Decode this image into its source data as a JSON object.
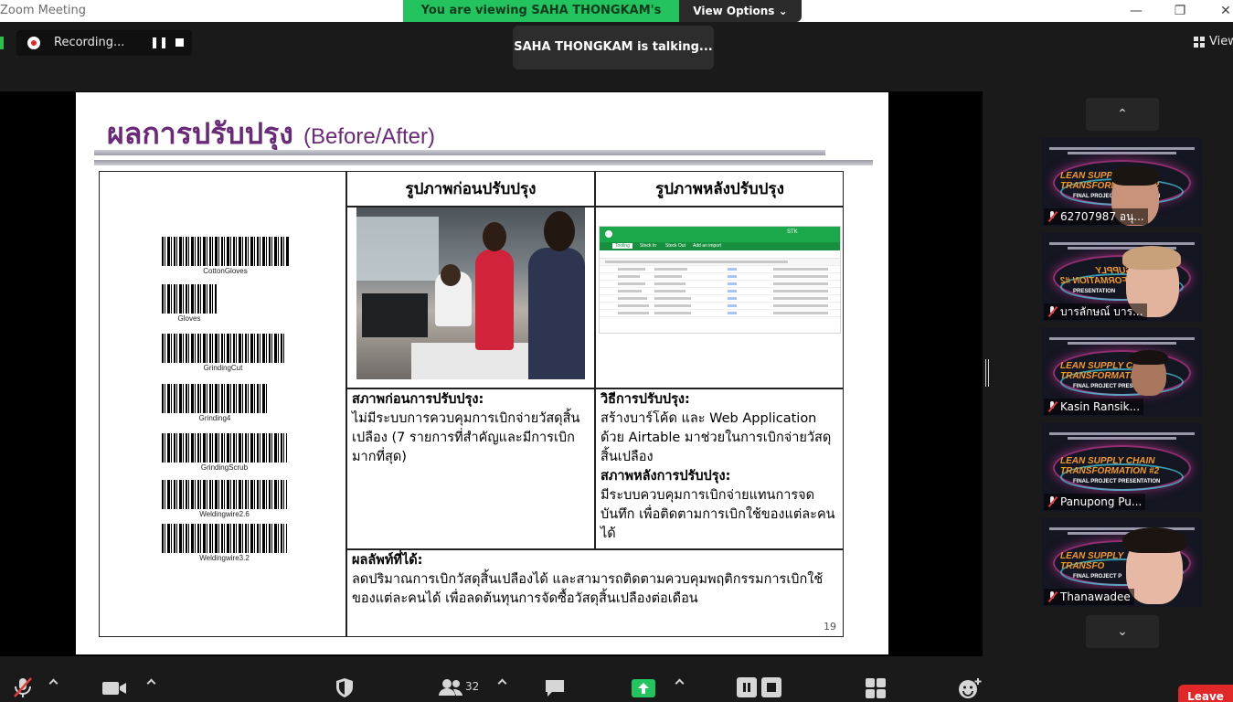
{
  "window": {
    "app_title": "Zoom Meeting",
    "viewing_banner": "You are viewing SAHA THONGKAM's screen",
    "view_options": "View Options",
    "view_options_caret": "⌄",
    "minimize": "—",
    "restore": "❐",
    "close": "✕"
  },
  "overlay": {
    "recording_label": "Recording...",
    "pause_glyph": "❚❚",
    "talking": "SAHA THONGKAM is talking...",
    "view_label": "View"
  },
  "slide": {
    "title": "ผลการปรับปรุง",
    "title_en": "(Before/After)",
    "barcodes": [
      "CottonGloves",
      "Gloves",
      "GrindingCut",
      "Grinding4",
      "GrindingScrub",
      "Weldingwire2.6",
      "Weldingwire3.2"
    ],
    "col_before_header": "รูปภาพก่อนปรับปรุง",
    "col_after_header": "รูปภาพหลังปรับปรุง",
    "airtable_header": "STK",
    "airtable_tabs": [
      "Tooling",
      "Stock In",
      "Stock Out",
      "Add an import"
    ],
    "before_heading": "สภาพก่อนการปรับปรุง:",
    "before_body": "ไม่มีระบบการควบคุมการเบิกจ่ายวัสดุสิ้นเปลือง (7 รายการที่สำคัญและมีการเบิกมากที่สุด)",
    "method_heading": "วิธีการปรับปรุง:",
    "method_body": "สร้างบาร์โค้ด และ Web Application ด้วย Airtable มาช่วยในการเบิกจ่ายวัสดุสิ้นเปลือง",
    "after_heading": "สภาพหลังการปรับปรุง:",
    "after_body": "มีระบบควบคุมการเบิกจ่ายแทนการจดบันทึก เพื่อติดตามการเบิกใช้ของแต่ละคนได้",
    "result_heading": "ผลลัพท์ที่ได้:",
    "result_body": "ลดปริมาณการเบิกวัสดุสิ้นเปลืองได้ และสามารถติดตามควบคุมพฤติกรรมการเบิกใช้ของแต่ละคนได้ เพื่อลดต้นทุนการจัดซื้อวัสดุสิ้นเปลืองต่อเดือน",
    "page_number": "19"
  },
  "participants": {
    "up_arrow": "⌃",
    "down_arrow": "⌄",
    "list": [
      {
        "name": "62707987 อนุ...",
        "lst_line1": "LEAN SUPPLY CHAIN",
        "lst_line2": "TRANSFORMATION #2",
        "fpp": "FINAL PROJECT PRESENTATION"
      },
      {
        "name": "บารลักษณ์ บาร...",
        "lst_line1": "LEAN SUPPLY",
        "lst_line2": "TRANSFORMATION #2",
        "fpp": "PRESENTATION"
      },
      {
        "name": "Kasin Ransik...",
        "lst_line1": "LEAN SUPPLY CHAIN",
        "lst_line2": "TRANSFORMATION #2",
        "fpp": "FINAL PROJECT PRESENTATION"
      },
      {
        "name": "Panupong Pu...",
        "lst_line1": "LEAN SUPPLY CHAIN",
        "lst_line2": "TRANSFORMATION #2",
        "fpp": "FINAL PROJECT PRESENTATION"
      },
      {
        "name": "Thanawadee",
        "lst_line1": "LEAN SUPPLY",
        "lst_line2": "TRANSFO",
        "fpp": "FINAL PROJECT P"
      }
    ]
  },
  "toolbar": {
    "participant_count": "32",
    "leave": "Leave"
  }
}
